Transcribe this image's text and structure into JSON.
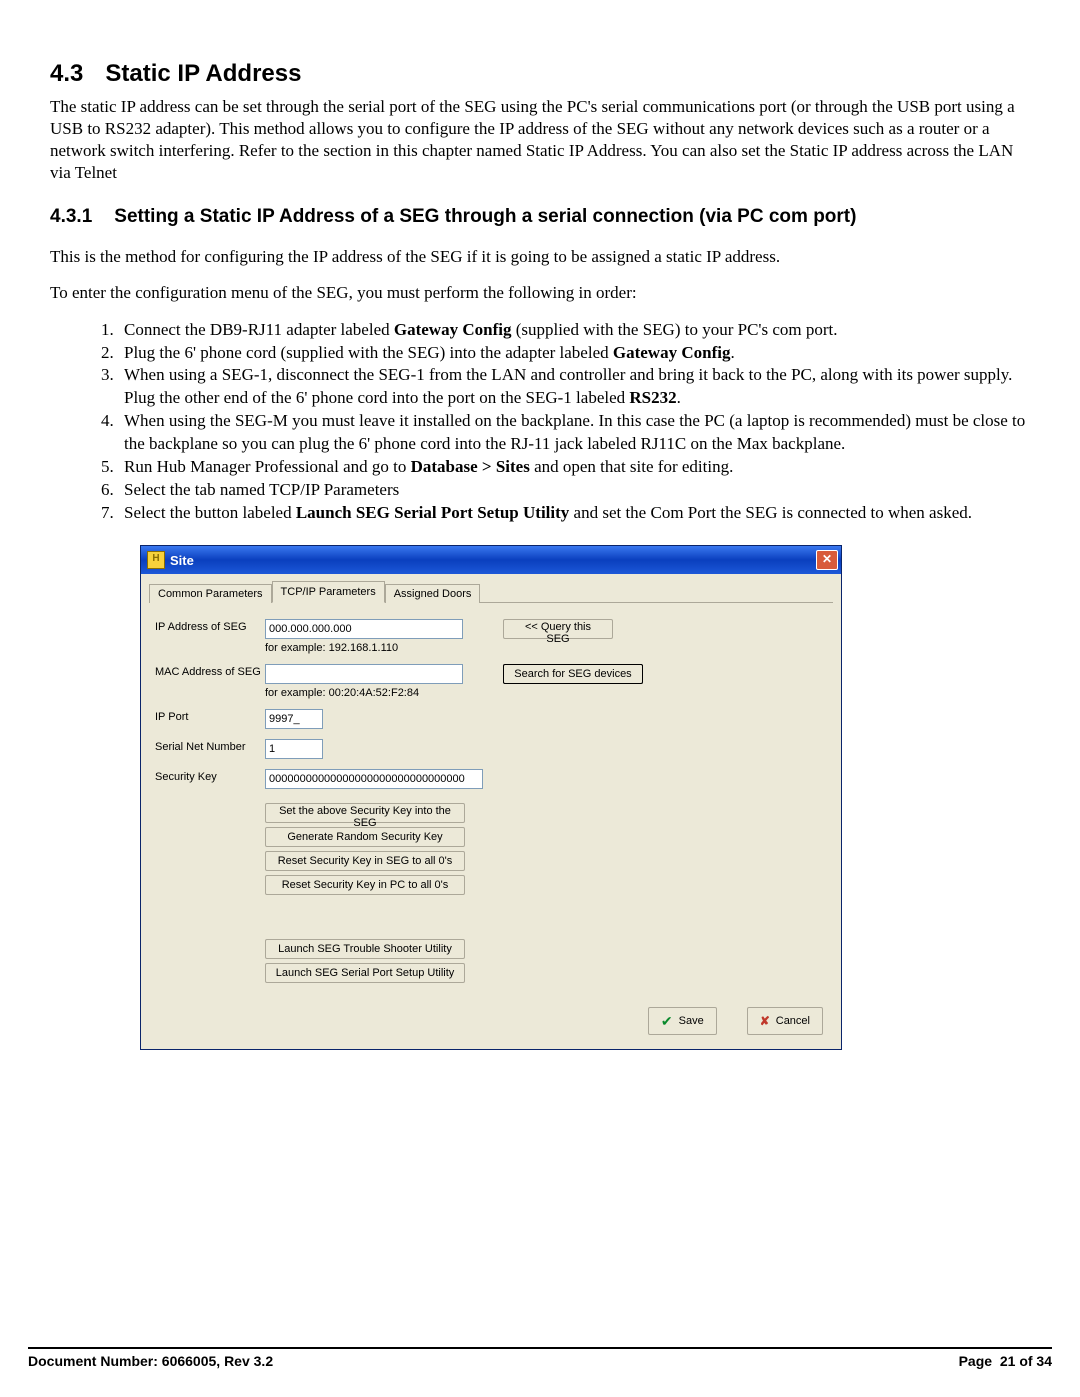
{
  "section": {
    "num": "4.3",
    "title": "Static IP Address",
    "intro": "The static IP address can be set through the serial port of the SEG using the PC's serial communications port (or through the USB port using a USB to RS232 adapter). This method allows you to configure the IP address of the SEG without any network devices such as a router or a network switch interfering. Refer to the section in this chapter named Static IP Address. You can also set the Static IP address across the LAN via Telnet"
  },
  "subsection": {
    "num": "4.3.1",
    "title": "Setting a Static IP Address of a SEG through a serial connection (via PC com port)",
    "p1": "This is the method for configuring the IP address of the SEG if it is going to be assigned a static IP address.",
    "p2": "To enter the configuration menu of the SEG, you must perform the following in order:"
  },
  "steps": [
    {
      "pre": "Connect the DB9-RJ11 adapter labeled ",
      "b": "Gateway Config",
      "post": " (supplied with the SEG) to your PC's com port."
    },
    {
      "pre": "Plug the 6' phone cord (supplied with the SEG) into the adapter labeled ",
      "b": "Gateway Config",
      "post": "."
    },
    {
      "pre": "When using a SEG-1, disconnect the SEG-1 from the LAN and controller and bring it back to the PC, along with its power supply. Plug the other end of the 6' phone cord into the port on the SEG-1 labeled ",
      "b": "RS232",
      "post": "."
    },
    {
      "pre": "When using the SEG-M you must leave it installed on the backplane. In this case the PC (a laptop is recommended) must be close to the backplane so you can plug the 6' phone cord into the RJ-11 jack labeled RJ11C on the Max backplane.",
      "b": "",
      "post": ""
    },
    {
      "pre": "Run Hub Manager Professional and go to ",
      "b": "Database > Sites",
      "post": " and open that site for editing."
    },
    {
      "pre": "Select the tab named TCP/IP Parameters",
      "b": "",
      "post": ""
    },
    {
      "pre": "Select the button labeled ",
      "b": "Launch SEG Serial Port Setup Utility",
      "post": " and set the Com Port the SEG is connected to when asked."
    }
  ],
  "dialog": {
    "title": "Site",
    "tabs": {
      "common": "Common Parameters",
      "tcpip": "TCP/IP Parameters",
      "doors": "Assigned Doors"
    },
    "labels": {
      "ip": "IP Address of SEG",
      "ip_help": "for example: 192.168.1.110",
      "mac": "MAC Address of SEG",
      "mac_help": "for example: 00:20:4A:52:F2:84",
      "port": "IP Port",
      "serial": "Serial Net Number",
      "seckey": "Security Key"
    },
    "values": {
      "ip": "000.000.000.000",
      "mac": "",
      "port": "9997_",
      "serial": "1",
      "seckey": "00000000000000000000000000000000"
    },
    "buttons": {
      "query": "<< Query this SEG",
      "search": "Search for SEG devices",
      "set_key": "Set the above Security Key into the SEG",
      "gen_key": "Generate Random Security Key",
      "reset_seg": "Reset Security Key in SEG to all 0's",
      "reset_pc": "Reset Security Key in PC to all 0's",
      "trouble": "Launch SEG Trouble Shooter Utility",
      "setup": "Launch SEG Serial Port Setup Utility",
      "save": "Save",
      "cancel": "Cancel"
    }
  },
  "footer": {
    "doc": "Document Number: 6066005, Rev 3.2",
    "page_label": "Page",
    "page_num": "21",
    "page_of_label": "of",
    "page_total": "34"
  }
}
